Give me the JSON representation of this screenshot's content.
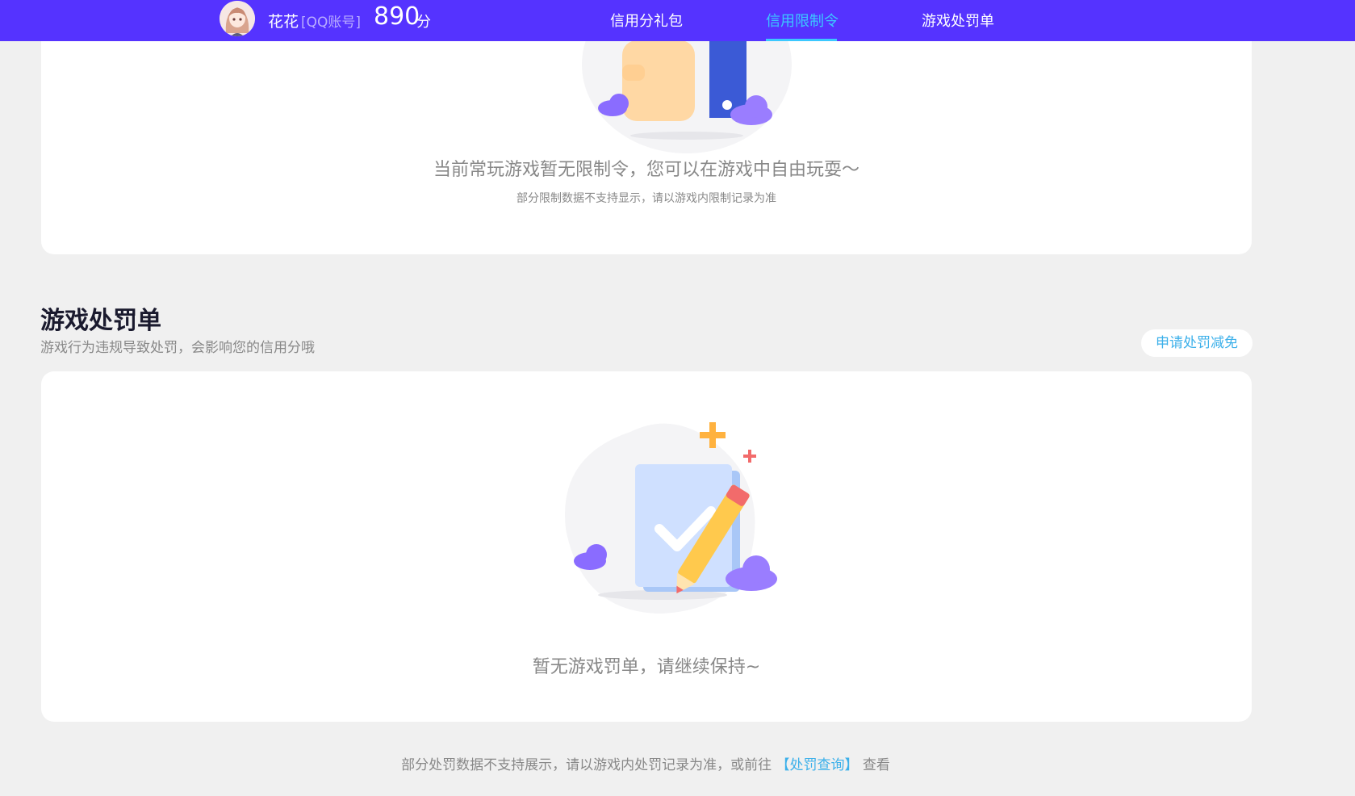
{
  "header": {
    "user_name": "花花",
    "account_type": "[QQ账号]",
    "score_value": "890",
    "score_unit": "分",
    "tabs": [
      {
        "label": "信用分礼包",
        "active": false
      },
      {
        "label": "信用限制令",
        "active": true
      },
      {
        "label": "游戏处罚单",
        "active": false
      }
    ],
    "accent_color": "#5533ff",
    "active_tab_color": "#3cc8ff"
  },
  "restriction_card": {
    "message": "当前常玩游戏暂无限制令，您可以在游戏中自由玩耍～",
    "note": "部分限制数据不支持显示，请以游戏内限制记录为准"
  },
  "penalty_section": {
    "title": "游戏处罚单",
    "subtitle": "游戏行为违规导致处罚，会影响您的信用分哦",
    "appeal_button": "申请处罚减免",
    "empty_message": "暂无游戏罚单，请继续保持~"
  },
  "footer": {
    "note_prefix": "部分处罚数据不支持展示，请以游戏内处罚记录为准，或前往",
    "link_text": "【处罚查询】",
    "note_suffix": "查看"
  }
}
